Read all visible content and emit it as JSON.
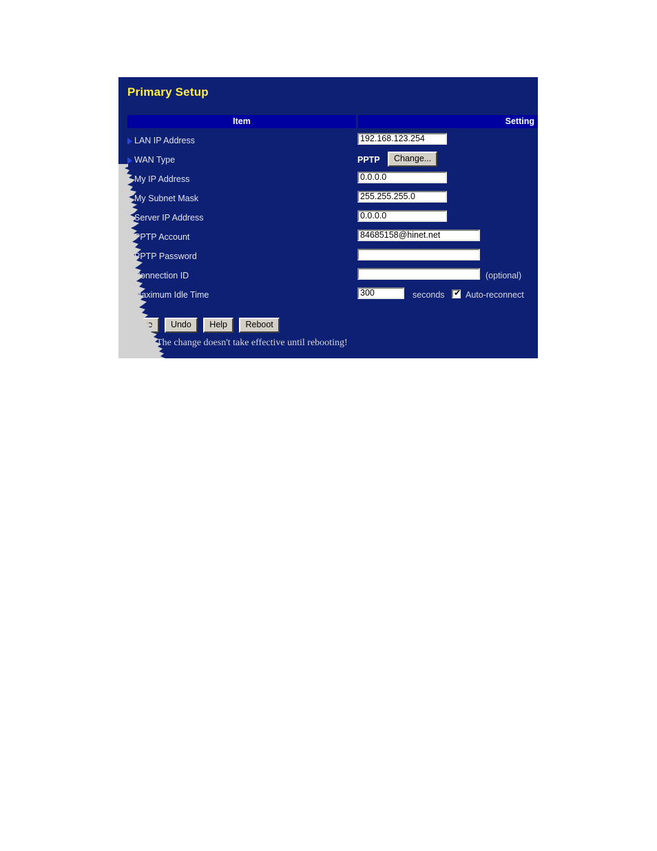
{
  "panel": {
    "title": "Primary Setup",
    "accent_title_color": "#ffee44",
    "background_color": "#0d2073",
    "header_row_color": "#0000a0"
  },
  "table": {
    "headers": {
      "item": "Item",
      "setting": "Setting"
    },
    "rows": [
      {
        "label": "LAN IP Address",
        "control": "text",
        "value": "192.168.123.254",
        "suffix": ""
      },
      {
        "label": "WAN Type",
        "control": "wan-type",
        "value": "PPTP",
        "button_label": "Change...",
        "suffix": ""
      },
      {
        "label": "My IP Address",
        "control": "text",
        "value": "0.0.0.0",
        "suffix": ""
      },
      {
        "label": "My Subnet Mask",
        "control": "text",
        "value": "255.255.255.0",
        "suffix": ""
      },
      {
        "label": "Server IP Address",
        "control": "text",
        "value": "0.0.0.0",
        "suffix": ""
      },
      {
        "label": "PPTP Account",
        "control": "text-wide",
        "value": "84685158@hinet.net",
        "suffix": ""
      },
      {
        "label": "PPTP Password",
        "control": "text-wide",
        "value": "",
        "suffix": ""
      },
      {
        "label": "Connection ID",
        "control": "text-wide",
        "value": "",
        "suffix": "(optional)"
      },
      {
        "label": "Maximum Idle Time",
        "control": "idle-time",
        "value": "300",
        "suffix": "seconds",
        "checkbox_label": "Auto-reconnect",
        "checkbox_checked": true
      }
    ]
  },
  "buttons": {
    "save": "Save",
    "undo": "Undo",
    "help": "Help",
    "reboot": "Reboot"
  },
  "status": {
    "message": "Saved! The change doesn't take effective until rebooting!"
  }
}
